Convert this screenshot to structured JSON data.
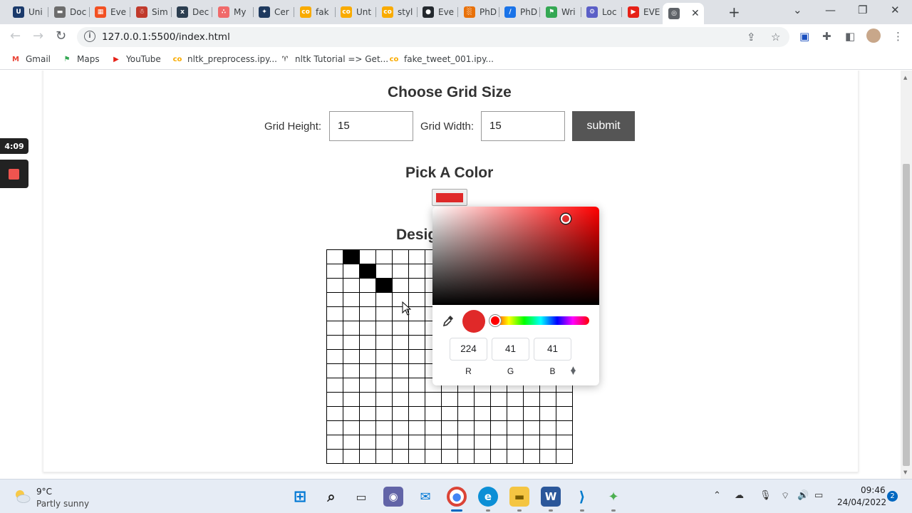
{
  "browser": {
    "tabs": [
      {
        "label": "Uni",
        "icon": "shield-logo-icon",
        "color": "#1b3a6b",
        "glyph": "U"
      },
      {
        "label": "Doc",
        "icon": "document-icon",
        "color": "#6d6d6d",
        "glyph": "▬"
      },
      {
        "label": "Eve",
        "icon": "microsoft-logo-icon",
        "color": "#f25022",
        "glyph": "▦"
      },
      {
        "label": "Sim",
        "icon": "character-icon",
        "color": "#c0392b",
        "glyph": "☃"
      },
      {
        "label": "Dec",
        "icon": "arxiv-icon",
        "color": "#2c3e50",
        "glyph": "x"
      },
      {
        "label": "My",
        "icon": "asana-icon",
        "color": "#f06a6a",
        "glyph": "∴"
      },
      {
        "label": "Cer",
        "icon": "certificate-icon",
        "color": "#1f3a5f",
        "glyph": "✦"
      },
      {
        "label": "fak",
        "icon": "colab-icon",
        "color": "#f9ab00",
        "glyph": "co"
      },
      {
        "label": "Unt",
        "icon": "colab-icon",
        "color": "#f9ab00",
        "glyph": "co"
      },
      {
        "label": "styl",
        "icon": "colab-icon",
        "color": "#f9ab00",
        "glyph": "co"
      },
      {
        "label": "Eve",
        "icon": "github-icon",
        "color": "#24292e",
        "glyph": "●"
      },
      {
        "label": "PhD",
        "icon": "chart-icon",
        "color": "#e8710a",
        "glyph": "░"
      },
      {
        "label": "PhD",
        "icon": "compass-icon",
        "color": "#1a73e8",
        "glyph": "∕"
      },
      {
        "label": "Wri",
        "icon": "bookmark-icon",
        "color": "#34a853",
        "glyph": "⚑"
      },
      {
        "label": "Loc",
        "icon": "gear-icon",
        "color": "#5b5fc7",
        "glyph": "⚙"
      },
      {
        "label": "EVE",
        "icon": "youtube-icon",
        "color": "#e62117",
        "glyph": "▶"
      },
      {
        "label": "",
        "icon": "globe-icon",
        "color": "#5f6368",
        "glyph": "◎"
      }
    ],
    "url": "127.0.0.1:5500/index.html",
    "bookmarks": [
      {
        "label": "Gmail",
        "icon": "gmail-icon",
        "color": "#ea4335",
        "glyph": "M"
      },
      {
        "label": "Maps",
        "icon": "maps-icon",
        "color": "#34a853",
        "glyph": "⚑"
      },
      {
        "label": "YouTube",
        "icon": "youtube-icon",
        "color": "#e62117",
        "glyph": "▶"
      },
      {
        "label": "nltk_preprocess.ipy...",
        "icon": "colab-icon",
        "color": "#f9ab00",
        "glyph": "co"
      },
      {
        "label": "nltk Tutorial => Get...",
        "icon": "figure-icon",
        "color": "#333333",
        "glyph": "♈"
      },
      {
        "label": "fake_tweet_001.ipy...",
        "icon": "colab-icon",
        "color": "#f9ab00",
        "glyph": "co"
      }
    ]
  },
  "page": {
    "grid_section_title": "Choose Grid Size",
    "height_label": "Grid Height:",
    "height_value": "15",
    "width_label": "Grid Width:",
    "width_value": "15",
    "submit_label": "submit",
    "color_section_title": "Pick A Color",
    "selected_color": "#e02929",
    "design_title_visible": "Desig",
    "grid": {
      "rows": 15,
      "cols": 15,
      "filled_cells": [
        [
          0,
          1
        ],
        [
          1,
          2
        ],
        [
          2,
          3
        ]
      ]
    }
  },
  "color_picker": {
    "r": "224",
    "g": "41",
    "b": "41",
    "r_label": "R",
    "g_label": "G",
    "b_label": "B",
    "hue_color": "#ff0000"
  },
  "recording": {
    "time": "4:09"
  },
  "taskbar": {
    "temperature": "9°C",
    "condition": "Partly sunny",
    "time": "09:46",
    "date": "24/04/2022",
    "notifications": "2"
  }
}
